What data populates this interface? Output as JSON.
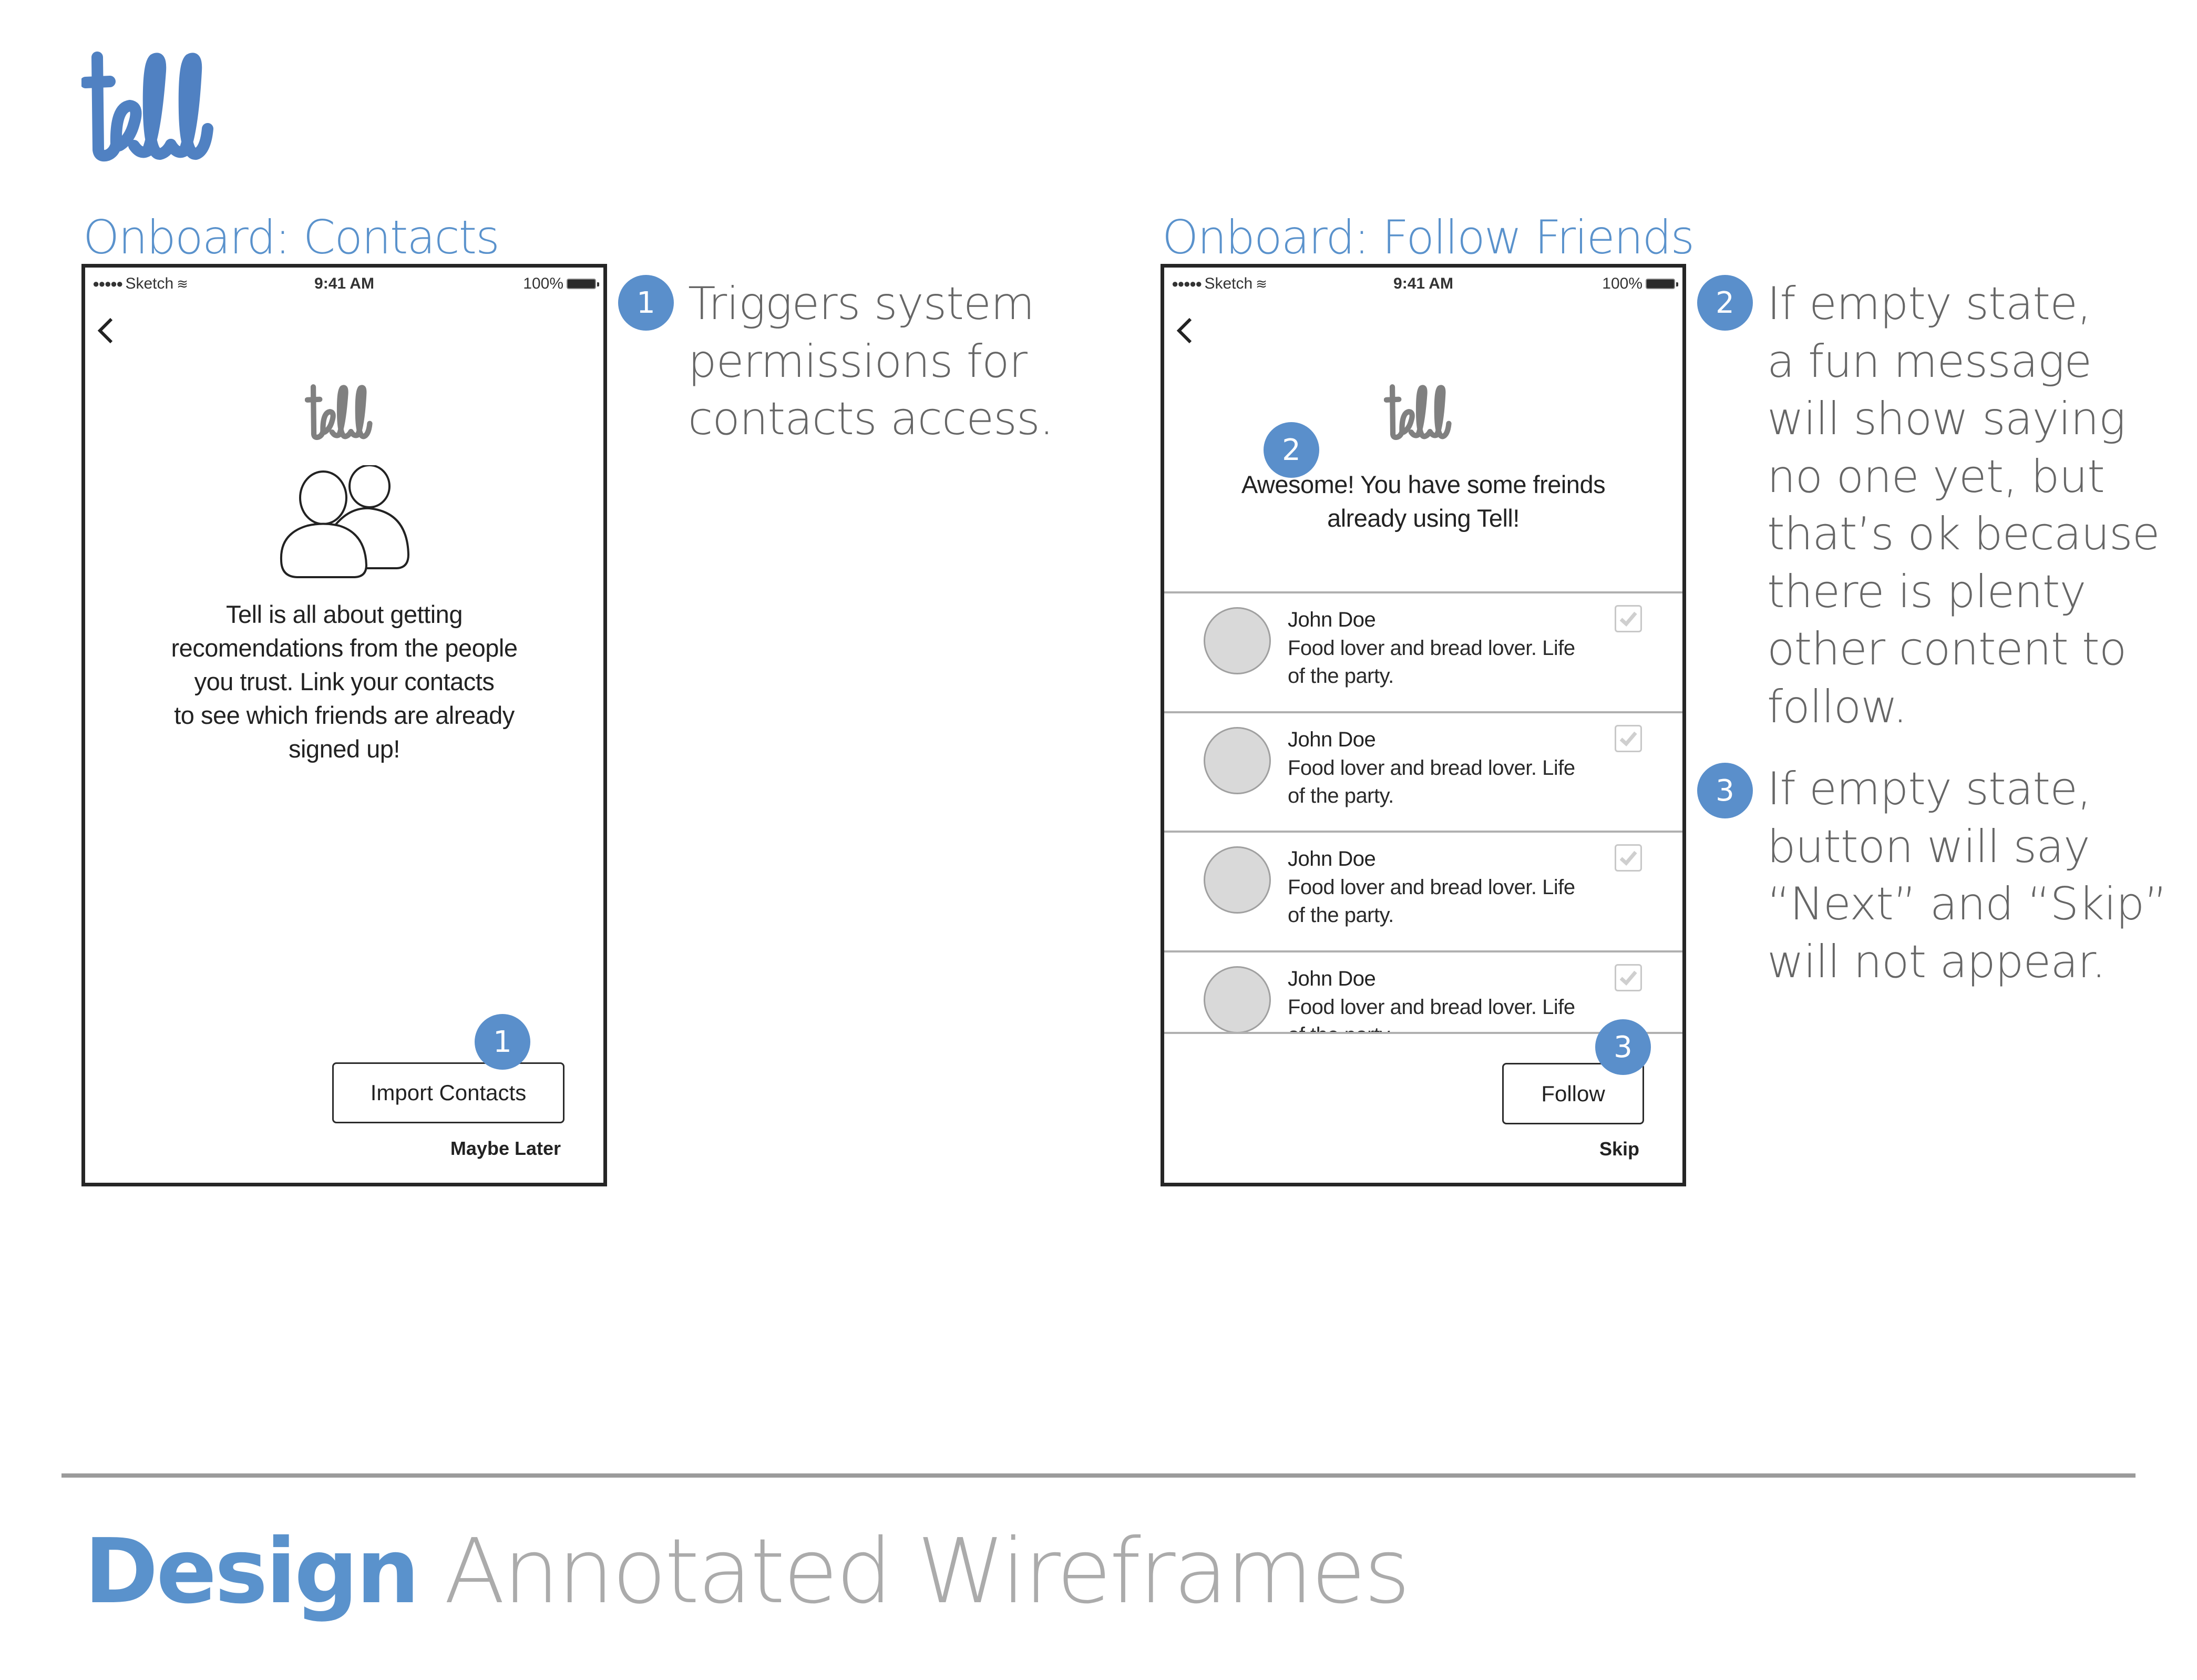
{
  "brand": {
    "logo_text": "tell",
    "brand_color": "#5a92cc",
    "badge_color": "#5a8fcb",
    "note_color": "#666666"
  },
  "status_bar": {
    "carrier": "Sketch",
    "time": "9:41 AM",
    "battery": "100%"
  },
  "screens": [
    {
      "title": "Onboard: Contacts",
      "logo_text": "tell",
      "body_lines": [
        "Tell is all about getting",
        "recomendations from the people",
        "you trust. Link your contacts",
        "to see which friends are already",
        "signed up!"
      ],
      "primary_button": "Import Contacts",
      "secondary_link": "Maybe Later",
      "badge": "1"
    },
    {
      "title": "Onboard: Follow Friends",
      "logo_text": "tell",
      "headline_lines": [
        "Awesome! You have some freinds",
        "already using Tell!"
      ],
      "headline_badge": "2",
      "friends": [
        {
          "name": "John Doe",
          "bio_lines": [
            "Food lover and bread lover. Life",
            "of the party."
          ],
          "checked": true
        },
        {
          "name": "John Doe",
          "bio_lines": [
            "Food lover and bread lover. Life",
            "of the party."
          ],
          "checked": true
        },
        {
          "name": "John Doe",
          "bio_lines": [
            "Food lover and bread lover. Life",
            "of the party."
          ],
          "checked": true
        },
        {
          "name": "John Doe",
          "bio_lines": [
            "Food lover and bread lover. Life",
            "of the party."
          ],
          "checked": true
        }
      ],
      "primary_button": "Follow",
      "button_badge": "3",
      "secondary_link": "Skip"
    }
  ],
  "annotations": [
    {
      "number": "1",
      "lines": [
        "Triggers system",
        "permissions for",
        "contacts access."
      ]
    },
    {
      "number": "2",
      "lines": [
        "If empty state,",
        "a fun message",
        "will show saying",
        "no one yet, but",
        "that’s ok because",
        "there is plenty",
        "other content to",
        "follow."
      ]
    },
    {
      "number": "3",
      "lines": [
        "If empty state,",
        "button will say",
        "“Next” and “Skip”",
        "will not appear."
      ]
    }
  ],
  "footer": {
    "strong": "Design",
    "light": "Annotated Wireframes"
  }
}
